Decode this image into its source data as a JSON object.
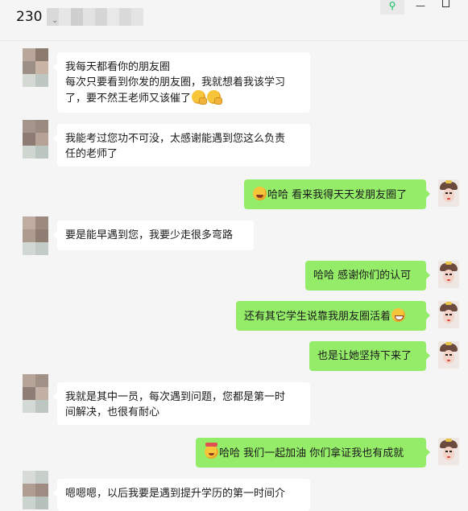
{
  "window": {
    "title_prefix": "230",
    "pin_glyph": "⚲",
    "minimize_glyph": "—"
  },
  "colors": {
    "background": "#f5f5f5",
    "incoming_bubble": "#ffffff",
    "outgoing_bubble": "#95ec69",
    "pin_accent": "#07c160"
  },
  "messages": [
    {
      "side": "in",
      "lines": [
        "我每天都看你的朋友圈",
        "每次只要看到你发的朋友圈，我就想着我该学习",
        "了，要不然王老师又该催了"
      ],
      "emoji_after": [
        "hand-over-mouth-emoji",
        "hand-over-mouth-emoji"
      ]
    },
    {
      "side": "in",
      "lines": [
        "我能考过您功不可没，太感谢能遇到您这么负责",
        "任的老师了"
      ]
    },
    {
      "side": "out",
      "emoji_before": "laughing-emoji",
      "lines": [
        "哈哈 看来我得天天发朋友圈了"
      ]
    },
    {
      "side": "in",
      "lines": [
        "要是能早遇到您，我要少走很多弯路"
      ]
    },
    {
      "side": "out",
      "lines": [
        "哈哈 感谢你们的认可"
      ]
    },
    {
      "side": "out",
      "lines": [
        "还有其它学生说靠我朋友圈活着"
      ],
      "emoji_after": [
        "grinning-emoji"
      ]
    },
    {
      "side": "out",
      "lines": [
        "也是让她坚持下来了"
      ]
    },
    {
      "side": "in",
      "lines": [
        "我就是其中一员，每次遇到问题，您都是第一时",
        "间解决，也很有耐心"
      ]
    },
    {
      "side": "out",
      "emoji_before": "cheering-emoji",
      "lines": [
        "哈哈 我们一起加油 你们拿证我也有成就"
      ]
    },
    {
      "side": "in",
      "lines": [
        "嗯嗯嗯，以后我要是遇到提升学历的第一时间介"
      ]
    }
  ]
}
